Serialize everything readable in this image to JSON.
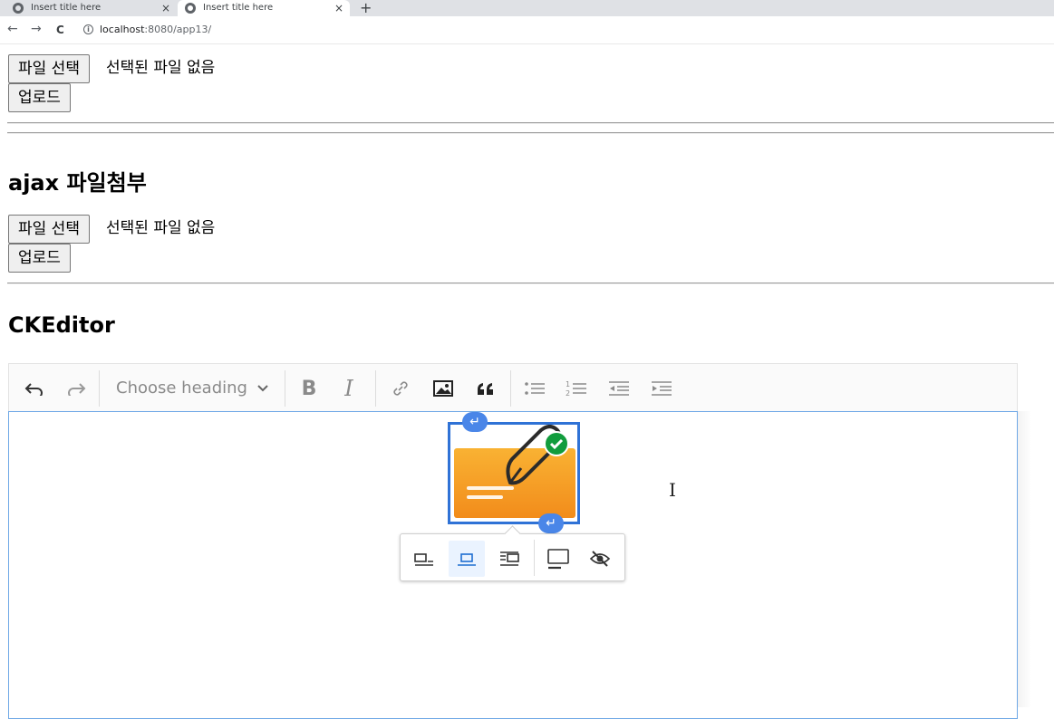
{
  "browser": {
    "tabs": [
      {
        "title": "Insert title here",
        "close": "×"
      },
      {
        "title": "Insert title here",
        "close": "×"
      }
    ],
    "new_tab": "+",
    "back": "←",
    "forward": "→",
    "reload": "C",
    "info": "i",
    "url_host": "localhost",
    "url_path": ":8080/app13/"
  },
  "form1": {
    "choose_file_label": "파일 선택",
    "no_file_text": "선택된 파일 없음",
    "upload_label": "업로드"
  },
  "ajax": {
    "heading": "ajax 파일첨부",
    "choose_file_label": "파일 선택",
    "no_file_text": "선택된 파일 없음",
    "upload_label": "업로드"
  },
  "editor": {
    "heading": "CKEditor",
    "heading_select": "Choose heading",
    "bold": "B",
    "italic": "I",
    "image_handle_icon": "↵",
    "cursor": "I",
    "toolbar_icons": [
      "undo-icon",
      "redo-icon",
      "bold-icon",
      "italic-icon",
      "link-icon",
      "image-icon",
      "blockquote-icon",
      "bulleted-list-icon",
      "numbered-list-icon",
      "outdent-icon",
      "indent-icon"
    ],
    "image_toolbar_icons": [
      "align-left-icon",
      "align-center-icon",
      "align-right-icon",
      "caption-icon",
      "hide-icon"
    ],
    "colors": {
      "selection": "#2f72d6",
      "ok_badge": "#119c3d",
      "envelope": "#f5a025"
    }
  }
}
